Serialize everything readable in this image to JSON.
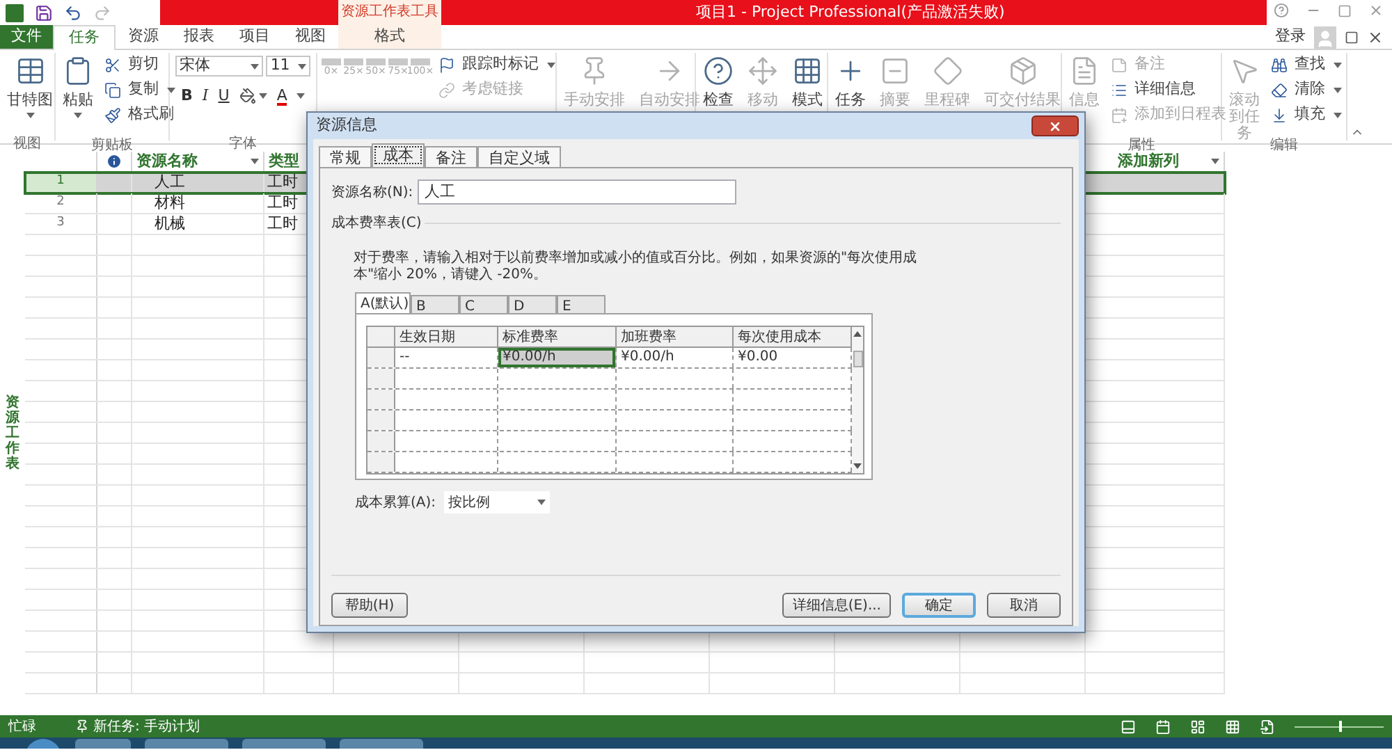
{
  "title_bar": {
    "contextual_group": "资源工作表工具",
    "title": "项目1 - Project Professional(产品激活失败)"
  },
  "ribbon_tabs": [
    {
      "label": "文件",
      "kind": "file",
      "selected": false
    },
    {
      "label": "任务",
      "kind": "normal",
      "selected": true
    },
    {
      "label": "资源",
      "kind": "normal",
      "selected": false
    },
    {
      "label": "报表",
      "kind": "normal",
      "selected": false
    },
    {
      "label": "项目",
      "kind": "normal",
      "selected": false
    },
    {
      "label": "视图",
      "kind": "normal",
      "selected": false
    },
    {
      "label": "格式",
      "kind": "contextual",
      "selected": false
    }
  ],
  "account": {
    "label": "登录"
  },
  "ribbon_groups": [
    {
      "label": "视图",
      "kind": "buttons",
      "items": [
        {
          "label": "甘特图",
          "kind": "large",
          "disabled": false,
          "dropdown": true
        }
      ]
    },
    {
      "label": "剪贴板",
      "kind": "buttons",
      "items": [
        {
          "label": "粘贴",
          "kind": "large",
          "disabled": false,
          "dropdown": true
        },
        {
          "label": "剪切",
          "kind": "small",
          "disabled": false,
          "dropdown": false
        },
        {
          "label": "复制",
          "kind": "small",
          "disabled": false,
          "dropdown": true
        },
        {
          "label": "格式刷",
          "kind": "small",
          "disabled": false,
          "dropdown": false
        }
      ]
    },
    {
      "label": "字体",
      "kind": "font",
      "font": "宋体",
      "size": "11",
      "styles": [
        "B",
        "I",
        "U"
      ],
      "font_color": "A"
    },
    {
      "kind": "buttons",
      "items": [
        {
          "label": "0×",
          "kind": "percent",
          "disabled": true
        },
        {
          "label": "25×",
          "kind": "percent",
          "disabled": true
        },
        {
          "label": "50×",
          "kind": "percent",
          "disabled": true
        },
        {
          "label": "75×",
          "kind": "percent",
          "disabled": true
        },
        {
          "label": "100×",
          "kind": "percent",
          "disabled": true
        },
        {
          "label": "跟踪时标记",
          "kind": "small",
          "disabled": false,
          "dropdown": true
        },
        {
          "label": "考虑链接",
          "kind": "small",
          "disabled": true,
          "dropdown": false
        }
      ]
    },
    {
      "kind": "buttons",
      "items": [
        {
          "label": "手动安排",
          "kind": "large",
          "disabled": true,
          "dropdown": false
        },
        {
          "label": "自动安排",
          "kind": "large",
          "disabled": true,
          "dropdown": false
        }
      ]
    },
    {
      "kind": "buttons",
      "items": [
        {
          "label": "检查",
          "kind": "large",
          "disabled": false,
          "dropdown": false
        },
        {
          "label": "移动",
          "kind": "large",
          "disabled": true,
          "dropdown": false
        },
        {
          "label": "模式",
          "kind": "large",
          "disabled": false,
          "dropdown": false
        }
      ]
    },
    {
      "kind": "buttons",
      "items": [
        {
          "label": "任务",
          "kind": "large",
          "disabled": false,
          "dropdown": false
        },
        {
          "label": "摘要",
          "kind": "large",
          "disabled": true,
          "dropdown": false
        },
        {
          "label": "里程碑",
          "kind": "large",
          "disabled": true,
          "dropdown": false
        },
        {
          "label": "可交付结果",
          "kind": "large",
          "disabled": true,
          "dropdown": false
        }
      ]
    },
    {
      "label": "属性",
      "kind": "buttons",
      "items": [
        {
          "label": "信息",
          "kind": "large",
          "disabled": true,
          "dropdown": false
        },
        {
          "label": "备注",
          "kind": "small",
          "disabled": true,
          "dropdown": false
        },
        {
          "label": "详细信息",
          "kind": "small",
          "disabled": false,
          "dropdown": false
        },
        {
          "label": "添加到日程表",
          "kind": "small",
          "disabled": true,
          "dropdown": false
        }
      ]
    },
    {
      "label": "编辑",
      "kind": "buttons",
      "items": [
        {
          "label": "滚动到任务",
          "kind": "large",
          "disabled": true,
          "dropdown": false
        },
        {
          "label": "查找",
          "kind": "small",
          "disabled": false,
          "dropdown": true
        },
        {
          "label": "清除",
          "kind": "small",
          "disabled": false,
          "dropdown": true
        },
        {
          "label": "填充",
          "kind": "small",
          "disabled": false,
          "dropdown": true
        }
      ]
    }
  ],
  "sheet": {
    "side_label": "资源工作表",
    "columns": [
      {
        "kind": "info"
      },
      {
        "label": "资源名称",
        "kind": "text"
      },
      {
        "label": "类型",
        "kind": "text"
      },
      {
        "label": "添加新列",
        "kind": "add"
      }
    ],
    "rows": [
      {
        "number": "1",
        "name": "人工",
        "type": "工时",
        "selected": true
      },
      {
        "number": "2",
        "name": "材料",
        "type": "工时",
        "selected": false
      },
      {
        "number": "3",
        "name": "机械",
        "type": "工时",
        "selected": false
      }
    ]
  },
  "status_bar": {
    "mode": "忙碌",
    "new_task": "新任务: 手动计划",
    "zoom": {
      "level": 0.5
    }
  },
  "dialog": {
    "title": "资源信息",
    "tabs": [
      {
        "label": "常规",
        "selected": false
      },
      {
        "label": "成本",
        "selected": true
      },
      {
        "label": "备注",
        "selected": false
      },
      {
        "label": "自定义域",
        "selected": false
      }
    ],
    "name_label": "资源名称(N):",
    "name_value": "人工",
    "section": "成本费率表(C)",
    "description": "对于费率，请输入相对于以前费率增加或减小的值或百分比。例如，如果资源的\"每次使用成本\"缩小 20%，请键入 -20%。",
    "rate_tabs": [
      {
        "label": "A(默认)",
        "selected": true
      },
      {
        "label": "B",
        "selected": false
      },
      {
        "label": "C",
        "selected": false
      },
      {
        "label": "D",
        "selected": false
      },
      {
        "label": "E",
        "selected": false
      }
    ],
    "grid_columns": [
      "生效日期",
      "标准费率",
      "加班费率",
      "每次使用成本"
    ],
    "grid_rows": [
      {
        "cells": [
          {
            "text": "--",
            "selected": false
          },
          {
            "text": "¥0.00/h",
            "selected": true
          },
          {
            "text": "¥0.00/h",
            "selected": false
          },
          {
            "text": "¥0.00",
            "selected": false
          }
        ]
      }
    ],
    "accrual_label": "成本累算(A):",
    "accrual_value": "按比例",
    "buttons": [
      {
        "label": "帮助(H)",
        "kind": "left",
        "default": false
      },
      {
        "label": "详细信息(E)...",
        "kind": "right",
        "default": false
      },
      {
        "label": "确定",
        "kind": "right",
        "default": true
      },
      {
        "label": "取消",
        "kind": "right",
        "default": false
      }
    ]
  }
}
